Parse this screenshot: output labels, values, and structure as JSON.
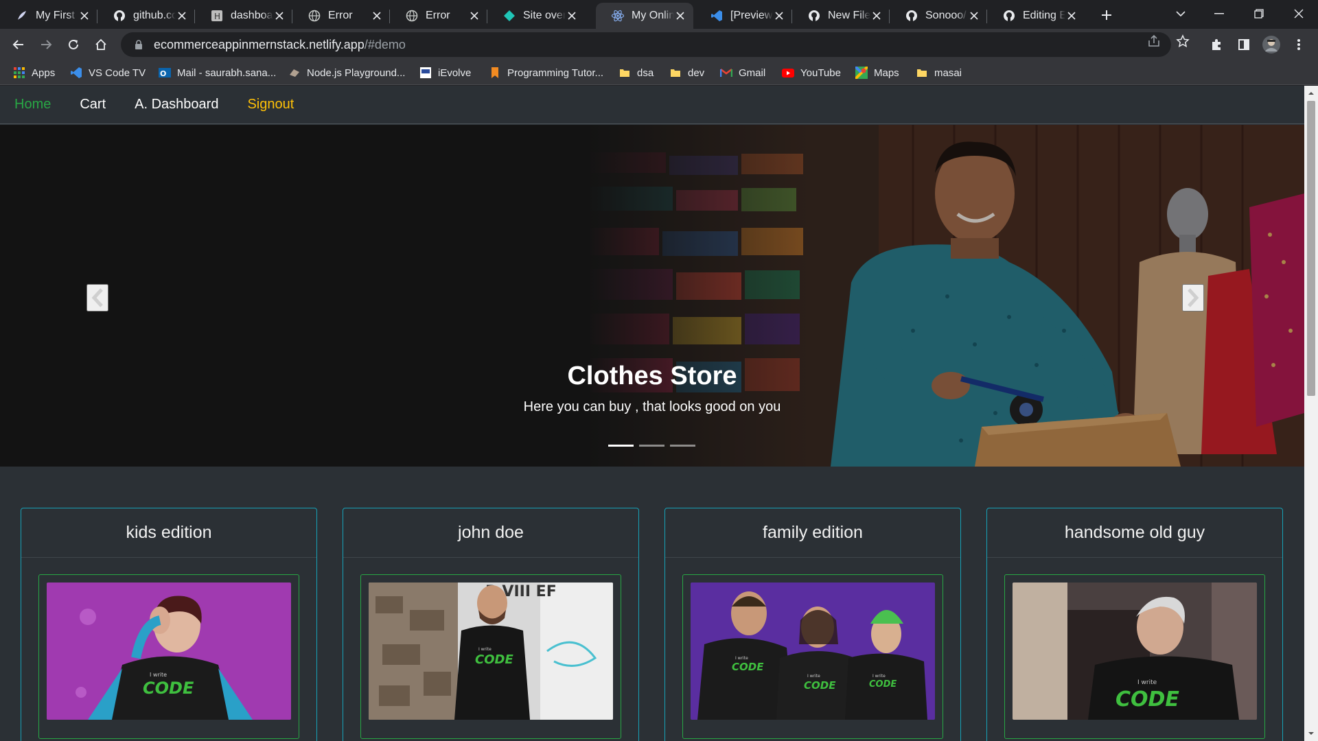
{
  "tabs": [
    {
      "title": "My First F",
      "icon": "quill-icon"
    },
    {
      "title": "github.co",
      "icon": "github-icon"
    },
    {
      "title": "dashboar",
      "icon": "hashnode-icon"
    },
    {
      "title": "Error",
      "icon": "globe-icon"
    },
    {
      "title": "Error",
      "icon": "globe-icon"
    },
    {
      "title": "Site overv",
      "icon": "netlify-icon"
    },
    {
      "title": "My Onlin",
      "icon": "react-icon",
      "active": true
    },
    {
      "title": "[Preview]",
      "icon": "vscode-icon"
    },
    {
      "title": "New File",
      "icon": "github-icon"
    },
    {
      "title": "Sonooo/",
      "icon": "github-icon"
    },
    {
      "title": "Editing E",
      "icon": "github-icon"
    }
  ],
  "address": {
    "host": "ecommerceappinmernstack.netlify.app",
    "path": "/#demo"
  },
  "bookmarks": [
    {
      "label": "Apps",
      "icon": "apps-grid-icon"
    },
    {
      "label": "VS Code TV",
      "icon": "vscode-icon"
    },
    {
      "label": "Mail - saurabh.sana...",
      "icon": "outlook-icon"
    },
    {
      "label": "Node.js Playground...",
      "icon": "node-icon"
    },
    {
      "label": "iEvolve",
      "icon": "tata-icon"
    },
    {
      "label": "Programming Tutor...",
      "icon": "bookmark-icon"
    },
    {
      "label": "dsa",
      "icon": "folder-icon"
    },
    {
      "label": "dev",
      "icon": "folder-icon"
    },
    {
      "label": "Gmail",
      "icon": "gmail-icon"
    },
    {
      "label": "YouTube",
      "icon": "youtube-icon"
    },
    {
      "label": "Maps",
      "icon": "maps-icon"
    },
    {
      "label": "masai",
      "icon": "folder-icon"
    }
  ],
  "nav": {
    "home": "Home",
    "cart": "Cart",
    "dashboard": "A. Dashboard",
    "signout": "Signout"
  },
  "hero": {
    "title": "Clothes Store",
    "subtitle": "Here you can buy , that looks good on you",
    "slide_count": 3,
    "active_slide": 1
  },
  "products": [
    {
      "title": "kids edition",
      "shirt_text": "I write CODE"
    },
    {
      "title": "john doe",
      "shirt_text": "I write CODE"
    },
    {
      "title": "family edition",
      "shirt_text": "I write CODE"
    },
    {
      "title": "handsome old guy",
      "shirt_text": "I write CODE"
    }
  ],
  "colors": {
    "nav_home": "#28a745",
    "nav_signout": "#ffc107",
    "card_border": "#17a2b8",
    "image_border": "#28a745",
    "page_bg": "#2b3035",
    "code_green": "#3fbf3f"
  }
}
